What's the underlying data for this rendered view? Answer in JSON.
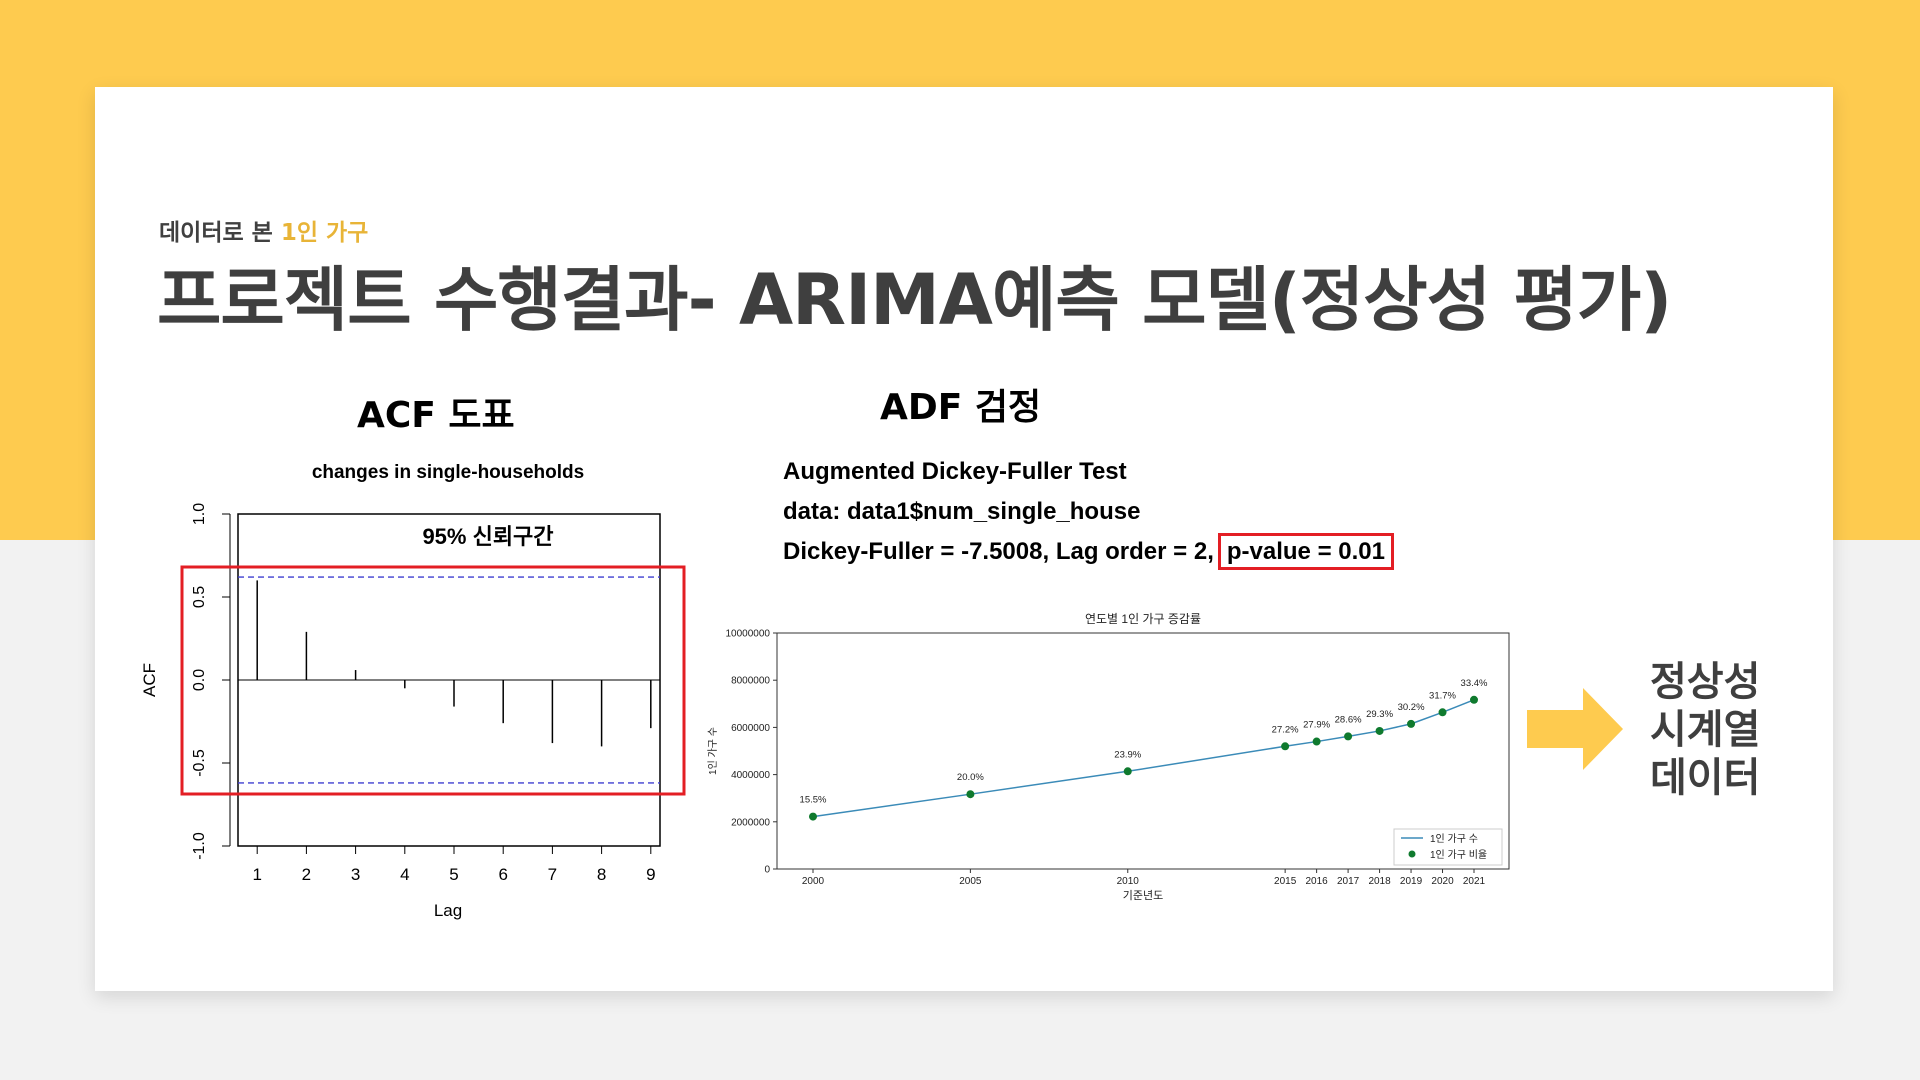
{
  "slide": {
    "subtitle_prefix": "데이터로 본 ",
    "subtitle_highlight": "1인 가구",
    "title": "프로젝트 수행결과- ARIMA예측 모델(정상성 평가)"
  },
  "acf_section": {
    "heading": "ACF 도표",
    "ci_label": "95% 신뢰구간"
  },
  "adf_section": {
    "heading": "ADF 검정",
    "line1": "Augmented Dickey-Fuller Test",
    "line2": "data:  data1$num_single_house",
    "line3_prefix": "Dickey-Fuller = -7.5008, Lag order = 2,",
    "line3_pvalue": "p-value = 0.01"
  },
  "conclusion": {
    "line1": "정상성",
    "line2": "시계열",
    "line3": "데이터"
  },
  "colors": {
    "accent_yellow": "#fecb4f",
    "highlight_text": "#e8b437",
    "highlight_box": "#e31e24",
    "line_series": "#3b8bb8",
    "point_series": "#0f7a2e"
  },
  "chart_data": [
    {
      "type": "bar",
      "title": "changes in single-households",
      "xlabel": "Lag",
      "ylabel": "ACF",
      "categories": [
        "1",
        "2",
        "3",
        "4",
        "5",
        "6",
        "7",
        "8",
        "9"
      ],
      "values": [
        0.6,
        0.29,
        0.06,
        -0.05,
        -0.16,
        -0.26,
        -0.38,
        -0.4,
        -0.29
      ],
      "ylim": [
        -1.0,
        1.0
      ],
      "yticks": [
        "-1.0",
        "-0.5",
        "0.0",
        "0.5",
        "1.0"
      ],
      "confidence_band": [
        -0.62,
        0.62
      ]
    },
    {
      "type": "line",
      "title": "연도별 1인 가구 증감률",
      "xlabel": "기준년도",
      "ylabel": "1인 가구 수",
      "x": [
        2000,
        2005,
        2010,
        2015,
        2016,
        2017,
        2018,
        2019,
        2020,
        2021
      ],
      "xticks": [
        "2000",
        "2005",
        "2010",
        "2015",
        "2016",
        "2017",
        "2018",
        "2019",
        "2020",
        "2021"
      ],
      "ylim": [
        0,
        10000000
      ],
      "yticks": [
        "0",
        "2000000",
        "4000000",
        "6000000",
        "8000000",
        "10000000"
      ],
      "legend_position": "bottom-right",
      "series": [
        {
          "name": "1인 가구 수",
          "values": [
            2220000,
            3170000,
            4140000,
            5200000,
            5400000,
            5620000,
            5850000,
            6150000,
            6640000,
            7170000
          ]
        },
        {
          "name": "1인 가구 비율",
          "labels": [
            "15.5%",
            "20.0%",
            "23.9%",
            "27.2%",
            "27.9%",
            "28.6%",
            "29.3%",
            "30.2%",
            "31.7%",
            "33.4%"
          ]
        }
      ]
    }
  ]
}
